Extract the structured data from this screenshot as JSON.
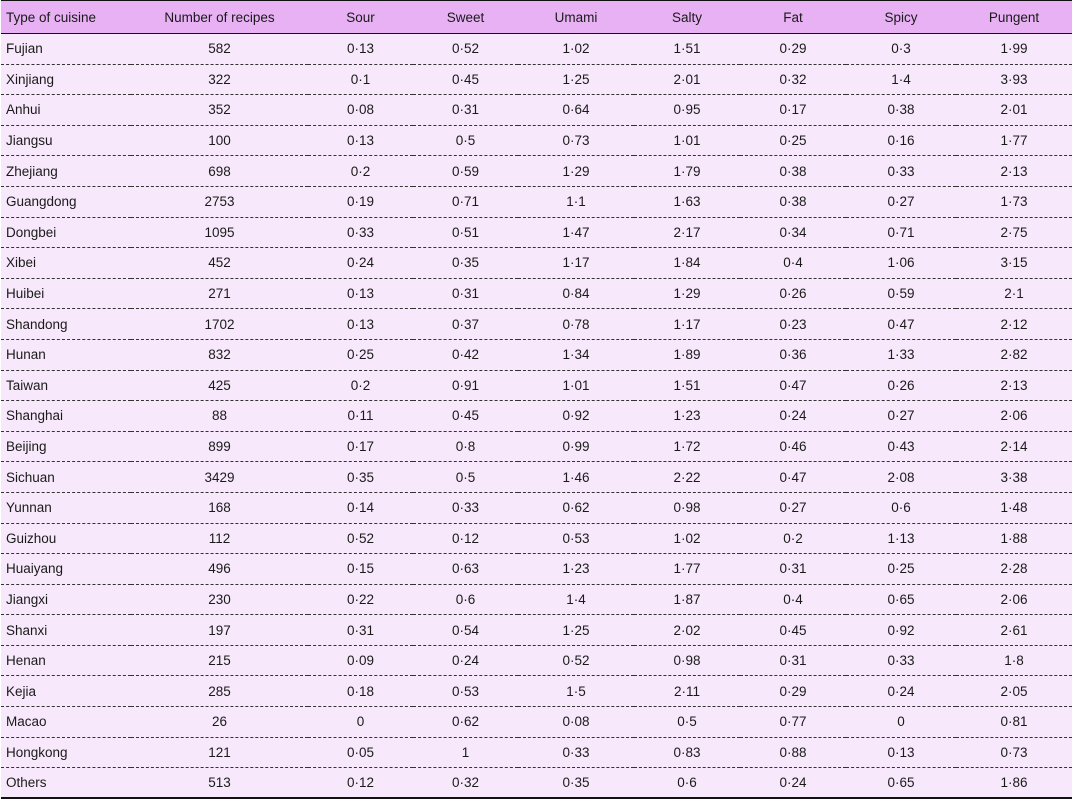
{
  "table": {
    "headers": [
      "Type of cuisine",
      "Number of recipes",
      "Sour",
      "Sweet",
      "Umami",
      "Salty",
      "Fat",
      "Spicy",
      "Pungent"
    ],
    "rows": [
      [
        "Fujian",
        "582",
        "0·13",
        "0·52",
        "1·02",
        "1·51",
        "0·29",
        "0·3",
        "1·99"
      ],
      [
        "Xinjiang",
        "322",
        "0·1",
        "0·45",
        "1·25",
        "2·01",
        "0·32",
        "1·4",
        "3·93"
      ],
      [
        "Anhui",
        "352",
        "0·08",
        "0·31",
        "0·64",
        "0·95",
        "0·17",
        "0·38",
        "2·01"
      ],
      [
        "Jiangsu",
        "100",
        "0·13",
        "0·5",
        "0·73",
        "1·01",
        "0·25",
        "0·16",
        "1·77"
      ],
      [
        "Zhejiang",
        "698",
        "0·2",
        "0·59",
        "1·29",
        "1·79",
        "0·38",
        "0·33",
        "2·13"
      ],
      [
        "Guangdong",
        "2753",
        "0·19",
        "0·71",
        "1·1",
        "1·63",
        "0·38",
        "0·27",
        "1·73"
      ],
      [
        "Dongbei",
        "1095",
        "0·33",
        "0·51",
        "1·47",
        "2·17",
        "0·34",
        "0·71",
        "2·75"
      ],
      [
        "Xibei",
        "452",
        "0·24",
        "0·35",
        "1·17",
        "1·84",
        "0·4",
        "1·06",
        "3·15"
      ],
      [
        "Huibei",
        "271",
        "0·13",
        "0·31",
        "0·84",
        "1·29",
        "0·26",
        "0·59",
        "2·1"
      ],
      [
        "Shandong",
        "1702",
        "0·13",
        "0·37",
        "0·78",
        "1·17",
        "0·23",
        "0·47",
        "2·12"
      ],
      [
        "Hunan",
        "832",
        "0·25",
        "0·42",
        "1·34",
        "1·89",
        "0·36",
        "1·33",
        "2·82"
      ],
      [
        "Taiwan",
        "425",
        "0·2",
        "0·91",
        "1·01",
        "1·51",
        "0·47",
        "0·26",
        "2·13"
      ],
      [
        "Shanghai",
        "88",
        "0·11",
        "0·45",
        "0·92",
        "1·23",
        "0·24",
        "0·27",
        "2·06"
      ],
      [
        "Beijing",
        "899",
        "0·17",
        "0·8",
        "0·99",
        "1·72",
        "0·46",
        "0·43",
        "2·14"
      ],
      [
        "Sichuan",
        "3429",
        "0·35",
        "0·5",
        "1·46",
        "2·22",
        "0·47",
        "2·08",
        "3·38"
      ],
      [
        "Yunnan",
        "168",
        "0·14",
        "0·33",
        "0·62",
        "0·98",
        "0·27",
        "0·6",
        "1·48"
      ],
      [
        "Guizhou",
        "112",
        "0·52",
        "0·12",
        "0·53",
        "1·02",
        "0·2",
        "1·13",
        "1·88"
      ],
      [
        "Huaiyang",
        "496",
        "0·15",
        "0·63",
        "1·23",
        "1·77",
        "0·31",
        "0·25",
        "2·28"
      ],
      [
        "Jiangxi",
        "230",
        "0·22",
        "0·6",
        "1·4",
        "1·87",
        "0·4",
        "0·65",
        "2·06"
      ],
      [
        "Shanxi",
        "197",
        "0·31",
        "0·54",
        "1·25",
        "2·02",
        "0·45",
        "0·92",
        "2·61"
      ],
      [
        "Henan",
        "215",
        "0·09",
        "0·24",
        "0·52",
        "0·98",
        "0·31",
        "0·33",
        "1·8"
      ],
      [
        "Kejia",
        "285",
        "0·18",
        "0·53",
        "1·5",
        "2·11",
        "0·29",
        "0·24",
        "2·05"
      ],
      [
        "Macao",
        "26",
        "0",
        "0·62",
        "0·08",
        "0·5",
        "0·77",
        "0",
        "0·81"
      ],
      [
        "Hongkong",
        "121",
        "0·05",
        "1",
        "0·33",
        "0·83",
        "0·88",
        "0·13",
        "0·73"
      ],
      [
        "Others",
        "513",
        "0·12",
        "0·32",
        "0·35",
        "0·6",
        "0·24",
        "0·65",
        "1·86"
      ]
    ]
  },
  "colors": {
    "header_bg": "#e7b1f3",
    "row_bg": "#f7e9fb",
    "text": "#1a1a1a"
  }
}
